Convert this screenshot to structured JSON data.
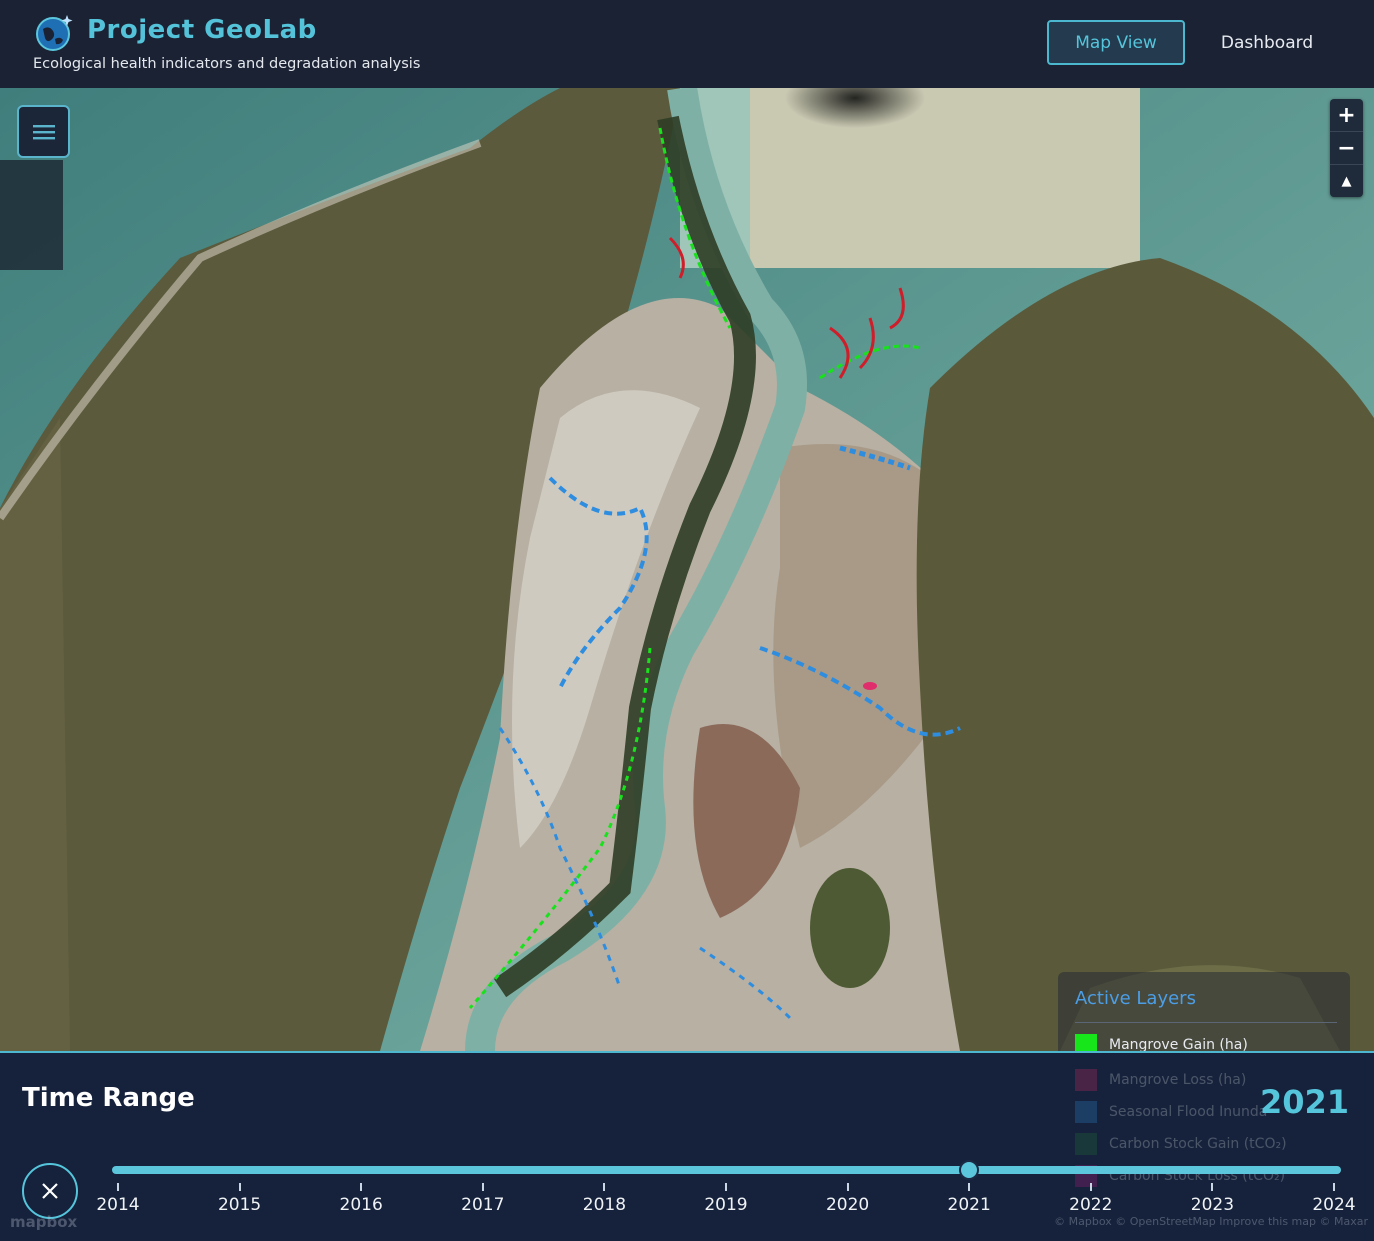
{
  "header": {
    "title": "Project GeoLab",
    "subtitle": "Ecological health indicators and degradation analysis",
    "nav": {
      "map_view": "Map View",
      "dashboard": "Dashboard"
    }
  },
  "map": {
    "zoom_in": "+",
    "zoom_out": "−",
    "compass": "▲",
    "legend": {
      "title": "Active Layers",
      "items": [
        {
          "label": "Mangrove Gain (ha)",
          "color": "#17e61a"
        },
        {
          "label": "Mangrove Loss (ha)",
          "color": "#e02d6c"
        },
        {
          "label": "Seasonal Flood Inunda",
          "color": "#2f8de0"
        },
        {
          "label": "Carbon Stock Gain (tCO₂)",
          "color": "#1f7a3a"
        },
        {
          "label": "Carbon Stock Loss (tCO₂)",
          "color": "#c2188a"
        }
      ]
    }
  },
  "timeline": {
    "title": "Time Range",
    "selected_year": "2021",
    "years": [
      "2014",
      "2015",
      "2016",
      "2017",
      "2018",
      "2019",
      "2020",
      "2021",
      "2022",
      "2023",
      "2024"
    ],
    "selected_fraction": 0.7,
    "watermark": "mapbox",
    "attribution": "© Mapbox © OpenStreetMap Improve this map © Maxar"
  },
  "colors": {
    "accent": "#55c5dc",
    "header_bg": "#1b2233",
    "panel_bg": "#16223c"
  }
}
